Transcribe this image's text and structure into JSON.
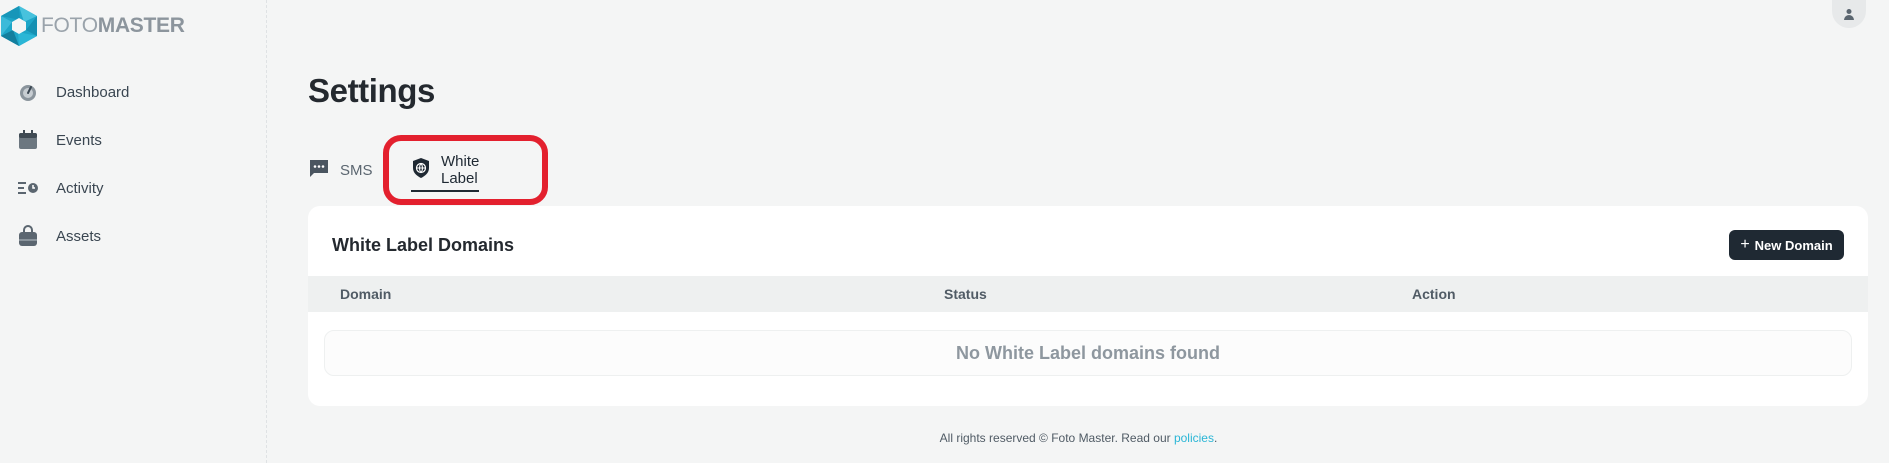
{
  "brand": {
    "name_thin": "FOTO",
    "name_bold": "MASTER"
  },
  "sidebar": {
    "items": [
      {
        "label": "Dashboard",
        "icon": "gauge-icon"
      },
      {
        "label": "Events",
        "icon": "calendar-icon"
      },
      {
        "label": "Activity",
        "icon": "activity-icon"
      },
      {
        "label": "Assets",
        "icon": "bag-icon"
      }
    ]
  },
  "header": {
    "avatar_icon": "user-icon"
  },
  "page": {
    "title": "Settings"
  },
  "tabs": [
    {
      "label": "SMS",
      "icon": "message-icon"
    },
    {
      "label": "White Label",
      "icon": "shield-globe-icon",
      "active": true
    }
  ],
  "card": {
    "title": "White Label Domains",
    "new_button": "New Domain",
    "columns": [
      "Domain",
      "Status",
      "Action"
    ],
    "empty_text": "No White Label domains found"
  },
  "footer": {
    "text": "All rights reserved © Foto Master. Read our ",
    "link": "policies",
    "suffix": "."
  },
  "colors": {
    "accent": "#1f2933",
    "highlight": "#e3202e",
    "link": "#2bb6d6",
    "logo": "#1ea6c8"
  }
}
